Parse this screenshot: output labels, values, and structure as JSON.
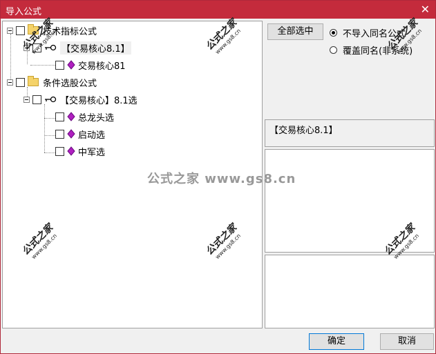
{
  "window": {
    "title": "导入公式",
    "close_glyph": "✕"
  },
  "tree": {
    "group1": {
      "label": "技术指标公式",
      "child": {
        "label": "【交易核心8.1】",
        "child": {
          "label": "交易核心81"
        }
      }
    },
    "group2": {
      "label": "条件选股公式",
      "child": {
        "label": "【交易核心】8.1选",
        "children": [
          {
            "label": "总龙头选"
          },
          {
            "label": "启动选"
          },
          {
            "label": "中军选"
          }
        ]
      }
    }
  },
  "right": {
    "select_all": "全部选中",
    "radio1": "不导入同名公式",
    "radio2": "覆盖同名(非系统)",
    "selected_title": "【交易核心8.1】"
  },
  "footer": {
    "ok": "确定",
    "cancel": "取消"
  },
  "watermark": {
    "center": "公式之家 www.gs8.cn",
    "big": "公式之家",
    "small": "www.gs8.cn"
  },
  "colors": {
    "titlebar": "#c42b3c",
    "folder": "#f5d36a",
    "gem": "#b020c0"
  }
}
